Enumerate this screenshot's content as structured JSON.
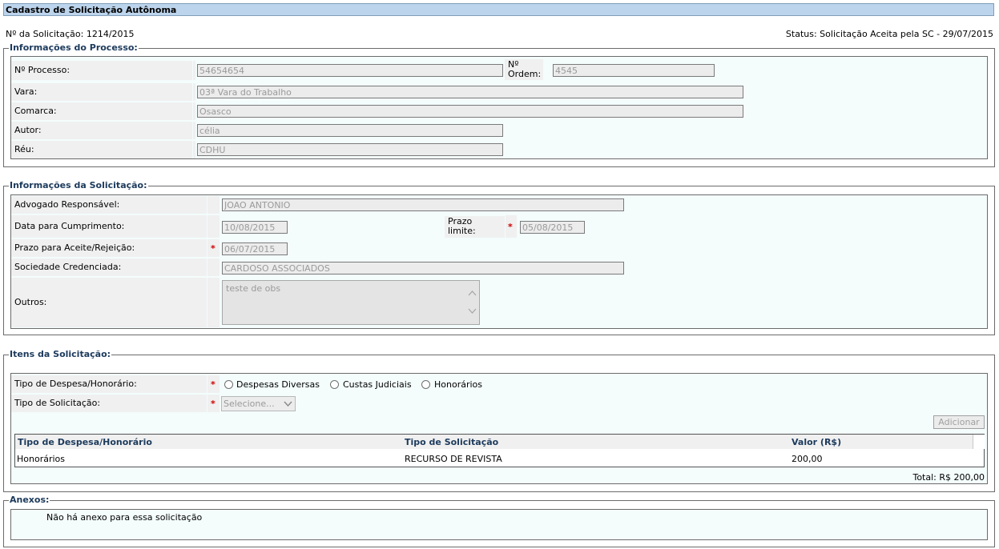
{
  "page": {
    "title": "Cadastro de Solicitação Autônoma",
    "request_number": "Nº da Solicitação: 1214/2015",
    "status": "Status: Solicitação Aceita pela SC - 29/07/2015"
  },
  "processo": {
    "legend": "Informações do Processo:",
    "num_label": "Nº Processo:",
    "num_value": "54654654",
    "ordem_label_1": "Nº",
    "ordem_label_2": "Ordem:",
    "ordem_value": "4545",
    "vara_label": "Vara:",
    "vara_value": "03ª Vara do Trabalho",
    "comarca_label": "Comarca:",
    "comarca_value": "Osasco",
    "autor_label": "Autor:",
    "autor_value": "célia",
    "reu_label": "Réu:",
    "reu_value": "CDHU"
  },
  "solicitacao": {
    "legend": "Informações da Solicitação:",
    "advogado_label": "Advogado Responsável:",
    "advogado_value": "JOAO ANTONIO",
    "data_label": "Data para Cumprimento:",
    "data_value": "10/08/2015",
    "prazo_limite_label_1": "Prazo",
    "prazo_limite_label_2": "limite:",
    "prazo_limite_value": "05/08/2015",
    "prazo_aceite_label": "Prazo para Aceite/Rejeição:",
    "prazo_aceite_value": "06/07/2015",
    "sociedade_label": "Sociedade Credenciada:",
    "sociedade_value": "CARDOSO ASSOCIADOS",
    "outros_label": "Outros:",
    "outros_value": "teste de obs",
    "required_mark": "*"
  },
  "itens": {
    "legend": "Itens da Solicitação:",
    "tipo_despesa_label": "Tipo de Despesa/Honorário:",
    "radio_options": [
      "Despesas Diversas",
      "Custas Judiciais",
      "Honorários"
    ],
    "tipo_solicitacao_label": "Tipo de Solicitação:",
    "tipo_solicitacao_selected": "Selecione...",
    "add_button": "Adicionar",
    "columns": [
      "Tipo de Despesa/Honorário",
      "Tipo de Solicitação",
      "Valor (R$)"
    ],
    "rows": [
      [
        "Honorários",
        "RECURSO DE REVISTA",
        "200,00"
      ]
    ],
    "total": "Total: R$ 200,00"
  },
  "anexos": {
    "legend": "Anexos:",
    "empty_message": "Não há anexo para essa solicitação"
  }
}
